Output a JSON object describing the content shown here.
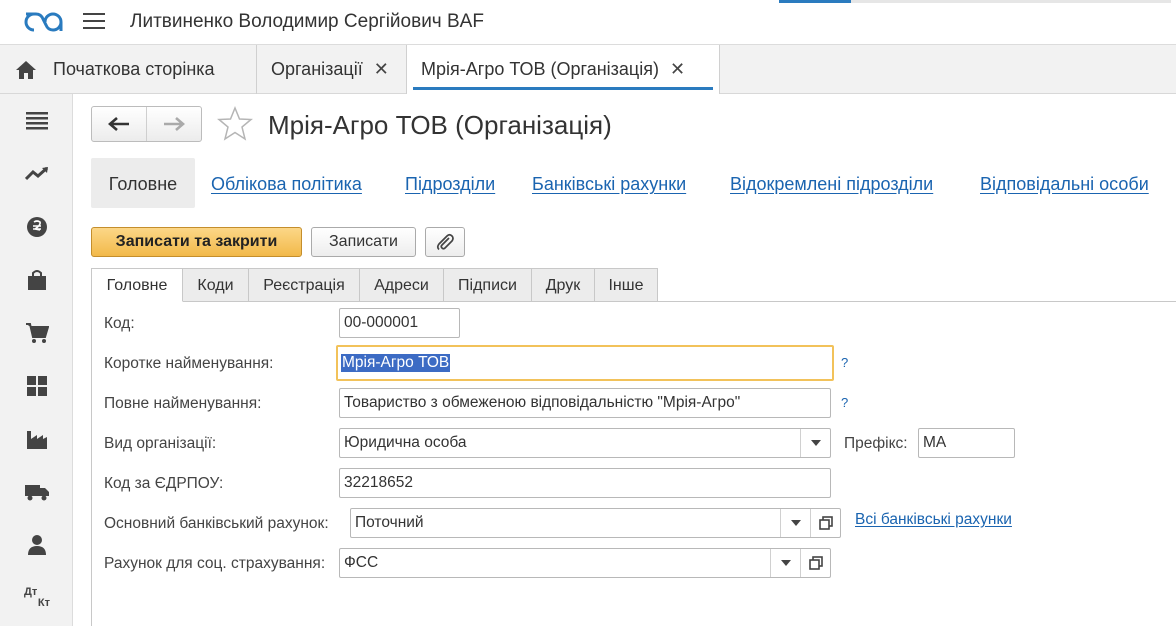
{
  "header": {
    "app_title": "Литвиненко Володимир Сергійович BAF",
    "logo_icon": "1c-logo-icon",
    "menu_icon": "hamburger-icon",
    "accent_color": "#2a7bbf"
  },
  "open_tabs": [
    {
      "label": "Початкова сторінка",
      "icon": "home-icon"
    },
    {
      "label": "Організації",
      "close": "✕"
    },
    {
      "label": "Мрія-Агро ТОВ (Організація)",
      "close": "✕",
      "active": true
    }
  ],
  "sidebar": {
    "items": [
      "menu-icon",
      "trend-icon",
      "currency-icon",
      "shopping-bag-icon",
      "cart-icon",
      "warehouse-icon",
      "factory-icon",
      "truck-icon",
      "person-icon",
      "debit-credit-icon"
    ],
    "dt_kt_label": {
      "top": "Дт",
      "bottom": "Кт"
    }
  },
  "form": {
    "title": "Мрія-Агро ТОВ (Організація)",
    "sections": [
      "Головне",
      "Облікова політика",
      "Підрозділи",
      "Банківські рахунки",
      "Відокремлені підрозділи",
      "Відповідальні особи"
    ],
    "buttons": {
      "save_close": "Записати та закрити",
      "save": "Записати"
    },
    "primary_color": "#f2b94a",
    "tabs": [
      "Головне",
      "Коди",
      "Реєстрація",
      "Адреси",
      "Підписи",
      "Друк",
      "Інше"
    ],
    "fields": {
      "code": {
        "label": "Код:",
        "value": "00-000001"
      },
      "short_name": {
        "label": "Коротке найменування:",
        "value": "Мрія-Агро ТОВ",
        "help": "?"
      },
      "full_name": {
        "label": "Повне найменування:",
        "value": "Товариство з обмеженою відповідальністю \"Мрія-Агро\"",
        "help": "?"
      },
      "org_type": {
        "label": "Вид організації:",
        "value": "Юридична особа"
      },
      "prefix": {
        "label": "Префікс:",
        "value": "МА"
      },
      "edrpou": {
        "label": "Код за ЄДРПОУ:",
        "value": "32218652"
      },
      "bank_account": {
        "label": "Основний банківський рахунок:",
        "value": "Поточний",
        "link": "Всі банківські рахунки"
      },
      "social_account": {
        "label": "Рахунок для соц. страхування:",
        "value": "ФСС"
      }
    }
  }
}
